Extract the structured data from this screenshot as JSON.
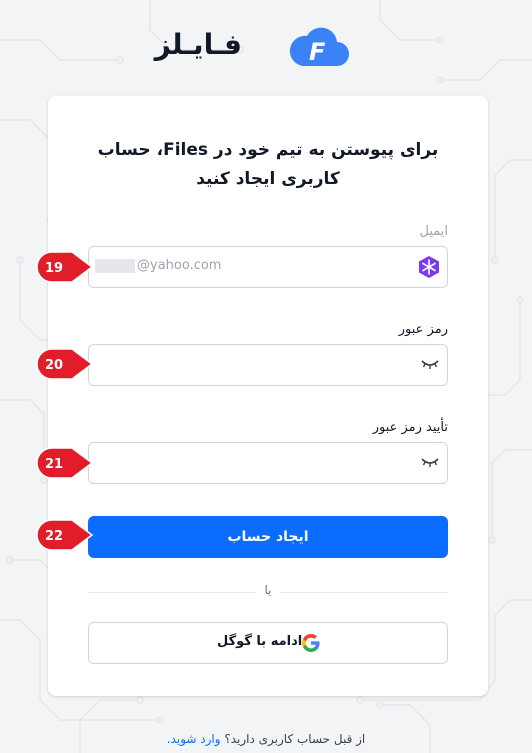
{
  "brand": {
    "logo_letter": "F",
    "name": "فـایـلز"
  },
  "card": {
    "title": "برای پیوستن به تیم خود در Files، حساب کاربری ایجاد کنید",
    "email": {
      "label": "ایمیل",
      "value_masked": "",
      "value_domain": "@yahoo.com",
      "extension_icon": "snowflake-icon"
    },
    "password": {
      "label": "رمز عبور",
      "value": "",
      "toggle_icon": "eye-closed-icon"
    },
    "confirm_password": {
      "label": "تأیید رمز عبور",
      "value": "",
      "toggle_icon": "eye-closed-icon"
    },
    "submit_label": "ایجاد حساب",
    "divider_text": "یا",
    "google_label": "ادامه با گوگل"
  },
  "footer": {
    "question": "از قبل حساب کاربری دارید؟",
    "login_link": "وارد شوید."
  },
  "markers": [
    {
      "number": "19"
    },
    {
      "number": "20"
    },
    {
      "number": "21"
    },
    {
      "number": "22"
    }
  ],
  "colors": {
    "primary": "#0b6cff",
    "marker": "#e11d2a",
    "logo": "#3b82f6"
  }
}
